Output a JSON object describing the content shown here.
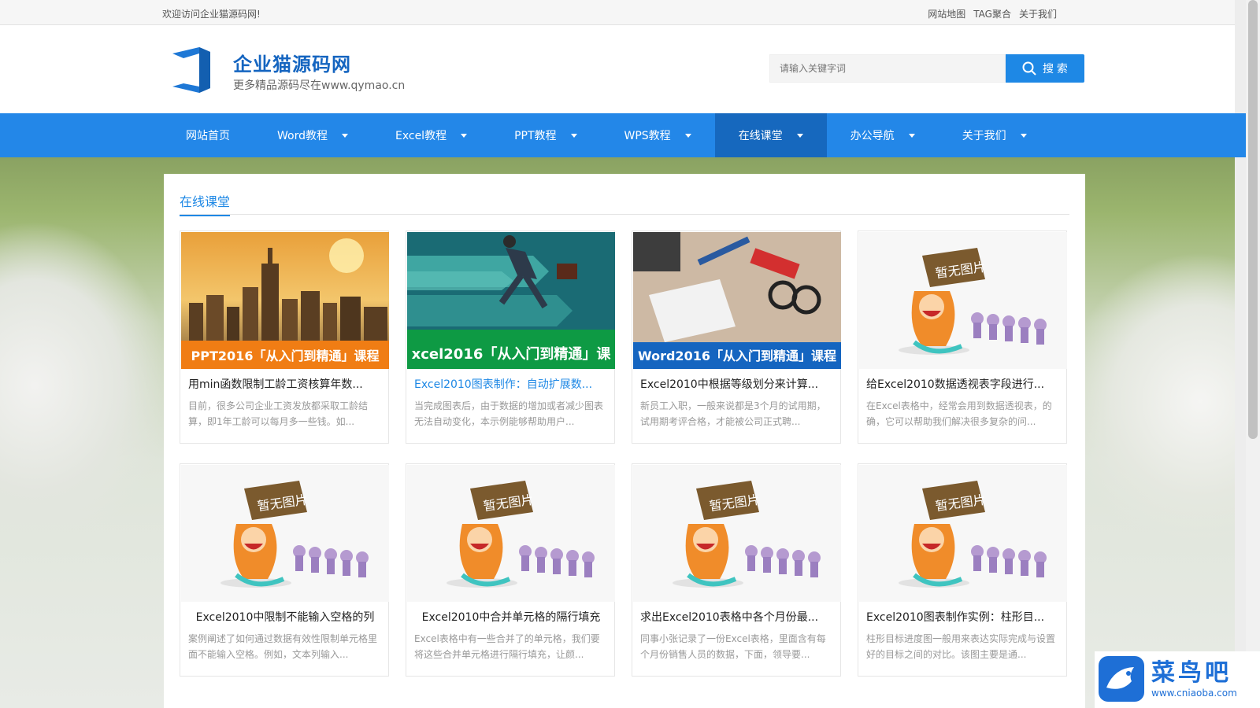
{
  "topbar": {
    "welcome": "欢迎访问企业猫源码网!",
    "links": [
      "网站地图",
      "TAG聚合",
      "关于我们"
    ]
  },
  "header": {
    "logo_icon": "square-logo-icon",
    "site_title": "企业猫源码网",
    "site_subtitle": "更多精品源码尽在www.qymao.cn",
    "search_placeholder": "请输入关键字词",
    "search_button": "搜 索"
  },
  "nav": {
    "items": [
      {
        "label": "网站首页",
        "dropdown": false
      },
      {
        "label": "Word教程",
        "dropdown": true
      },
      {
        "label": "Excel教程",
        "dropdown": true
      },
      {
        "label": "PPT教程",
        "dropdown": true
      },
      {
        "label": "WPS教程",
        "dropdown": true
      },
      {
        "label": "在线课堂",
        "dropdown": true,
        "active": true
      },
      {
        "label": "办公导航",
        "dropdown": true
      },
      {
        "label": "关于我们",
        "dropdown": true
      }
    ]
  },
  "section": {
    "title": "在线课堂"
  },
  "cards": [
    {
      "image": "city-skyline",
      "banner": "PPT2016「从入门到精通」课程",
      "title": "用min函数限制工龄工资核算年数...",
      "desc": "目前，很多公司企业工资发放都采取工龄结算，即1年工龄可以每月多一些钱。如..."
    },
    {
      "image": "running-businessman",
      "banner": "xcel2016「从入门到精通」课",
      "title": "Excel2010图表制作：自动扩展数...",
      "desc": "当完成图表后，由于数据的增加或者减少图表无法自动变化，本示例能够帮助用户..."
    },
    {
      "image": "desk-supplies",
      "banner": "Word2016「从入门到精通」课程",
      "title": "Excel2010中根据等级划分来计算...",
      "desc": "新员工入职，一般来说都是3个月的试用期，试用期考评合格，才能被公司正式聘..."
    },
    {
      "image": "no-image-placeholder",
      "banner": "暂无图片",
      "title": "给Excel2010数据透视表字段进行...",
      "desc": "在Excel表格中，经常会用到数据透视表，的确，它可以帮助我们解决很多复杂的问..."
    },
    {
      "image": "no-image-placeholder",
      "banner": "暂无图片",
      "title": "Excel2010中限制不能输入空格的列",
      "desc": "案例阐述了如何通过数据有效性限制单元格里面不能输入空格。例如，文本列输入..."
    },
    {
      "image": "no-image-placeholder",
      "banner": "暂无图片",
      "title": "Excel2010中合并单元格的隔行填充",
      "desc": "Excel表格中有一些合并了的单元格，我们要将这些合并单元格进行隔行填充，让颜..."
    },
    {
      "image": "no-image-placeholder",
      "banner": "暂无图片",
      "title": "求出Excel2010表格中各个月份最...",
      "desc": "同事小张记录了一份Excel表格，里面含有每个月份销售人员的数据，下面，领导要..."
    },
    {
      "image": "no-image-placeholder",
      "banner": "暂无图片",
      "title": "Excel2010图表制作实例：柱形目...",
      "desc": "柱形目标进度图一般用来表达实际完成与设置好的目标之间的对比。该图主要是通..."
    }
  ],
  "watermark": {
    "text": "菜鸟吧",
    "url": "www.cniaoba.com"
  },
  "colors": {
    "nav_bg": "#2387e8",
    "nav_active": "#1668be",
    "accent": "#1e88e5"
  }
}
